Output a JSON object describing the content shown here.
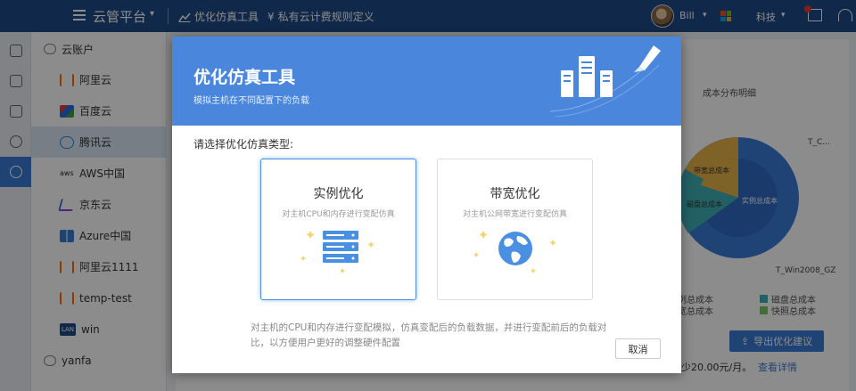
{
  "topbar": {
    "brand": "云管平台",
    "nav": [
      {
        "label": "优化仿真工具",
        "icon": "line-chart-icon"
      },
      {
        "label": "私有云计费规则定义",
        "icon": "pricing-icon"
      }
    ],
    "user": "Bill",
    "org": "科技"
  },
  "sidebar": {
    "groups": [
      {
        "label": "云账户",
        "items": [
          {
            "label": "阿里云",
            "color": "#ff6a00"
          },
          {
            "label": "百度云",
            "color": "#2a6fdb"
          },
          {
            "label": "腾讯云",
            "color": "#2a8be6",
            "active": true
          },
          {
            "label": "AWS中国",
            "color": "#222222"
          },
          {
            "label": "京东云",
            "color": "#8a3fd0"
          },
          {
            "label": "Azure中国",
            "color": "#3a7bd5"
          },
          {
            "label": "阿里云1111",
            "color": "#ff6a00"
          },
          {
            "label": "temp-test",
            "color": "#ff6a00"
          },
          {
            "label": "win",
            "color": "#1e4a86"
          }
        ]
      },
      {
        "label": "yanfa",
        "items": []
      }
    ]
  },
  "background": {
    "chart_title": "成本分布明细",
    "pie_labels": [
      "T_C...",
      "带宽总成本",
      "实例总成本",
      "磁盘总成本",
      "T_Win2008_GZ"
    ],
    "legend": [
      {
        "label": "例总成本",
        "color": "#3a7bd5"
      },
      {
        "label": "磁盘总成本",
        "color": "#3fb0b5"
      },
      {
        "label": "宽总成本",
        "color": "#e6b34a"
      },
      {
        "label": "快照总成本",
        "color": "#7cc36a"
      }
    ],
    "export_label": "导出优化建议",
    "price_text": "少20.00元/月。",
    "detail_link": "查看详情"
  },
  "modal": {
    "title": "优化仿真工具",
    "subtitle": "模拟主机在不同配置下的负载",
    "prompt": "请选择优化仿真类型:",
    "cards": [
      {
        "title": "实例优化",
        "desc": "对主机CPU和内存进行变配仿真",
        "selected": true
      },
      {
        "title": "带宽优化",
        "desc": "对主机公网带宽进行变配仿真",
        "selected": false
      }
    ],
    "note": "对主机的CPU和内存进行变配模拟，仿真变配后的负载数据，并进行变配前后的负载对比，以方便用户更好的调整硬件配置",
    "cancel_label": "取消",
    "colors": {
      "header": "#4a86dc",
      "accent": "#4a90e2"
    }
  }
}
